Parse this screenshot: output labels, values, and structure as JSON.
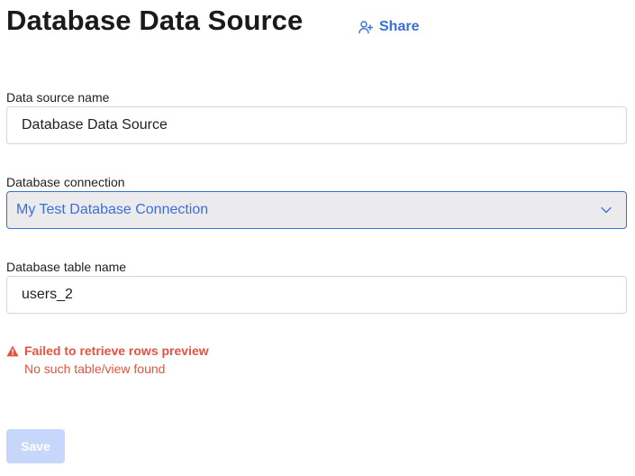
{
  "header": {
    "title": "Database Data Source",
    "share_label": "Share",
    "share_icon": "user-plus-icon"
  },
  "form": {
    "name_field": {
      "label": "Data source name",
      "value": "Database Data Source"
    },
    "connection_field": {
      "label": "Database connection",
      "selected": "My Test Database Connection",
      "icon": "chevron-down-icon"
    },
    "table_field": {
      "label": "Database table name",
      "value": "users_2"
    }
  },
  "error": {
    "icon": "warning-icon",
    "title": "Failed to retrieve rows preview",
    "message": "No such table/view found"
  },
  "actions": {
    "save_label": "Save",
    "save_disabled": true
  },
  "colors": {
    "accent": "#3b6fd8",
    "error": "#e5533f",
    "select_bg": "#ebebee",
    "disabled_button": "#c6d7fb"
  }
}
